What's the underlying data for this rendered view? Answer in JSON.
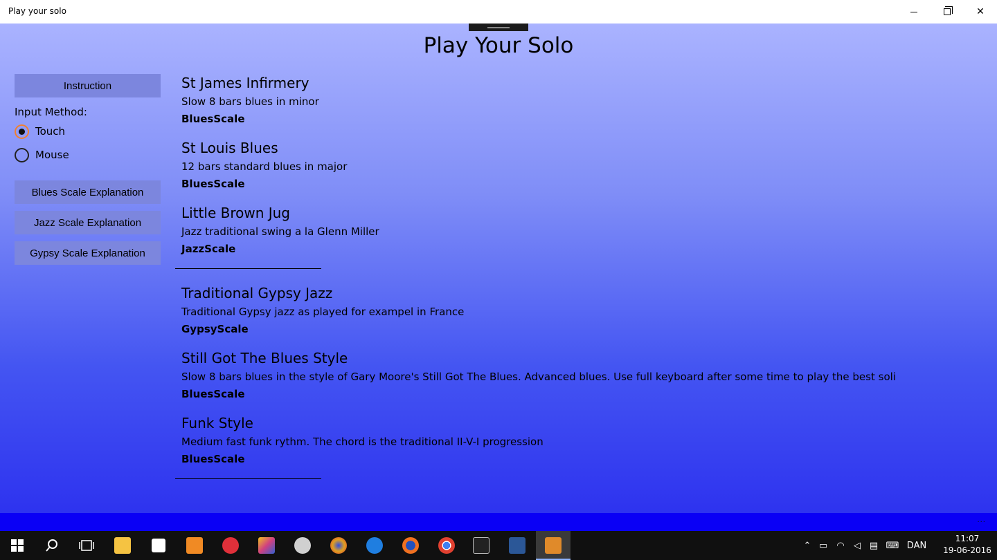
{
  "window": {
    "title": "Play your solo",
    "minimize_icon": "minimize-icon",
    "maximize_icon": "restore-icon",
    "close_glyph": "✕"
  },
  "app": {
    "title": "Play Your Solo"
  },
  "sidebar": {
    "instruction_label": "Instruction",
    "input_method_label": "Input Method:",
    "input_options": [
      {
        "label": "Touch",
        "selected": true
      },
      {
        "label": "Mouse",
        "selected": false
      }
    ],
    "explanations": [
      {
        "label": "Blues Scale Explanation"
      },
      {
        "label": "Jazz Scale Explanation"
      },
      {
        "label": "Gypsy Scale Explanation"
      }
    ]
  },
  "songs": [
    {
      "title": "St James Infirmery",
      "description": "Slow 8 bars blues in minor",
      "scale": "BluesScale"
    },
    {
      "title": "St Louis Blues",
      "description": "12 bars standard blues in major",
      "scale": "BluesScale"
    },
    {
      "title": "Little Brown Jug",
      "description": "Jazz traditional swing a la Glenn Miller",
      "scale": "JazzScale"
    },
    {
      "title": "Traditional Gypsy Jazz",
      "description": "Traditional Gypsy jazz as played for exampel in France",
      "scale": "GypsyScale"
    },
    {
      "title": "Still Got The Blues Style",
      "description": "Slow 8 bars blues in the style of Gary Moore's Still Got The Blues. Advanced blues. Use full keyboard after some time to play the best soli",
      "scale": "BluesScale"
    },
    {
      "title": "Funk Style",
      "description": "Medium fast funk rythm. The chord is the traditional II-V-I progression",
      "scale": "BluesScale"
    }
  ],
  "app_bar": {
    "more_glyph": "..."
  },
  "taskbar": {
    "icons": [
      "windows-start-icon",
      "search-icon",
      "task-view-icon",
      "file-explorer-icon",
      "store-icon",
      "media-player-icon",
      "app-red-icon",
      "paint-icon",
      "snipping-icon",
      "color-app-icon",
      "edge-icon",
      "firefox-icon",
      "chrome-icon",
      "cmd-icon",
      "word-icon",
      "play-your-solo-icon"
    ],
    "language": "DAN",
    "time": "11:07",
    "date": "19-06-2016"
  },
  "colors": {
    "titlebar_bg": "#ffffff",
    "gradient_top": "#aab3ff",
    "gradient_bottom": "#2e33ef",
    "button_bg": "#7c86de",
    "app_bar_bg": "#0a00f5",
    "taskbar_bg": "#101010",
    "radio_accent": "#f08030"
  }
}
